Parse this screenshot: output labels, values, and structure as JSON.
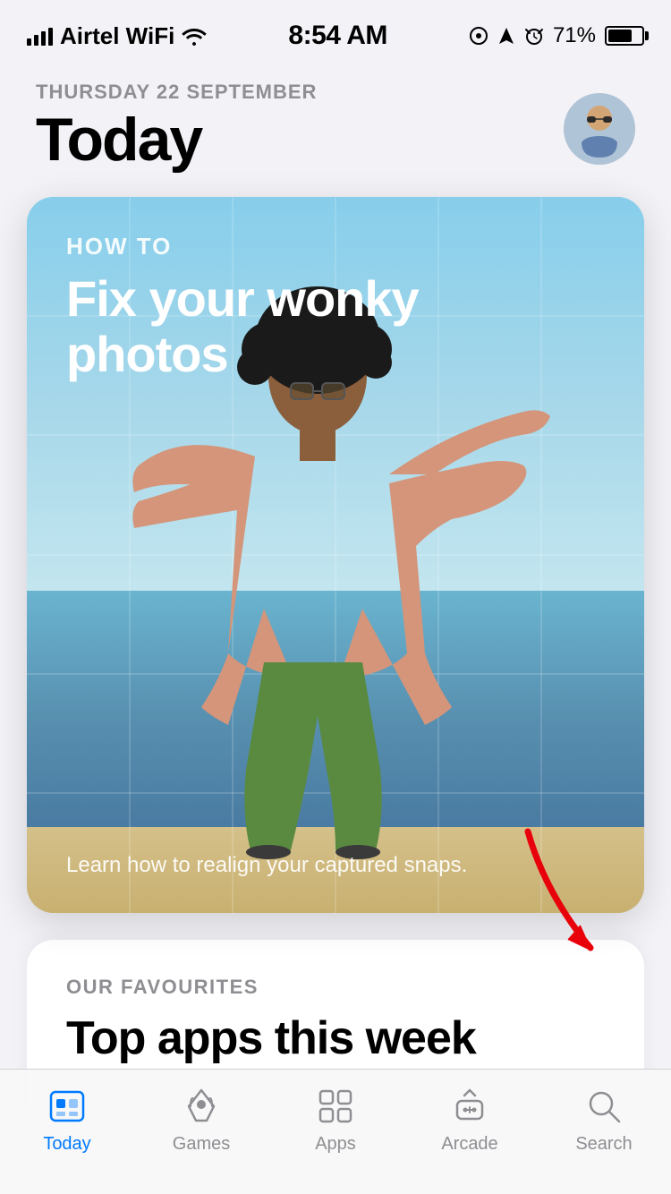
{
  "status_bar": {
    "carrier": "Airtel WiFi",
    "time": "8:54 AM",
    "battery": "71%"
  },
  "header": {
    "date": "THURSDAY 22 SEPTEMBER",
    "title": "Today"
  },
  "featured_card": {
    "how_to_label": "HOW TO",
    "title": "Fix your wonky photos",
    "subtitle": "Learn how to realign your captured snaps."
  },
  "second_card": {
    "label": "OUR FAVOURITES",
    "title": "Top apps this week"
  },
  "tab_bar": {
    "items": [
      {
        "id": "today",
        "label": "Today",
        "active": true
      },
      {
        "id": "games",
        "label": "Games",
        "active": false
      },
      {
        "id": "apps",
        "label": "Apps",
        "active": false
      },
      {
        "id": "arcade",
        "label": "Arcade",
        "active": false
      },
      {
        "id": "search",
        "label": "Search",
        "active": false
      }
    ]
  },
  "colors": {
    "active_tab": "#007aff",
    "inactive_tab": "#8e8e93",
    "card_bg_top": "#87ceeb",
    "red_arrow": "#e8000b"
  }
}
